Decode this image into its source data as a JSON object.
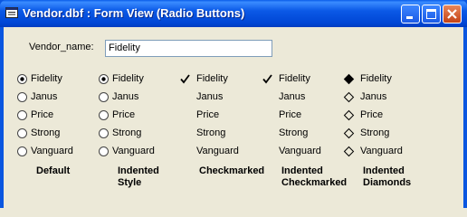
{
  "window": {
    "title": "Vendor.dbf : Form View (Radio Buttons)",
    "icon": "form-view-icon"
  },
  "form": {
    "field_label": "Vendor_name:",
    "field_value": "Fidelity"
  },
  "options": [
    "Fidelity",
    "Janus",
    "Price",
    "Strong",
    "Vanguard"
  ],
  "groups": [
    {
      "caption_lines": [
        "Default"
      ],
      "style": "radio",
      "selected": "Fidelity"
    },
    {
      "caption_lines": [
        "Indented",
        "Style"
      ],
      "style": "radio-indented",
      "selected": "Fidelity"
    },
    {
      "caption_lines": [
        "Checkmarked"
      ],
      "style": "checkmark",
      "selected": "Fidelity"
    },
    {
      "caption_lines": [
        "Indented",
        "Checkmarked"
      ],
      "style": "checkmark-indented",
      "selected": "Fidelity"
    },
    {
      "caption_lines": [
        "Indented",
        "Diamonds"
      ],
      "style": "diamond",
      "selected": "Fidelity"
    }
  ],
  "colors": {
    "titlebar": "#0a56e0",
    "client": "#ece9d8",
    "close_button": "#c44216"
  }
}
